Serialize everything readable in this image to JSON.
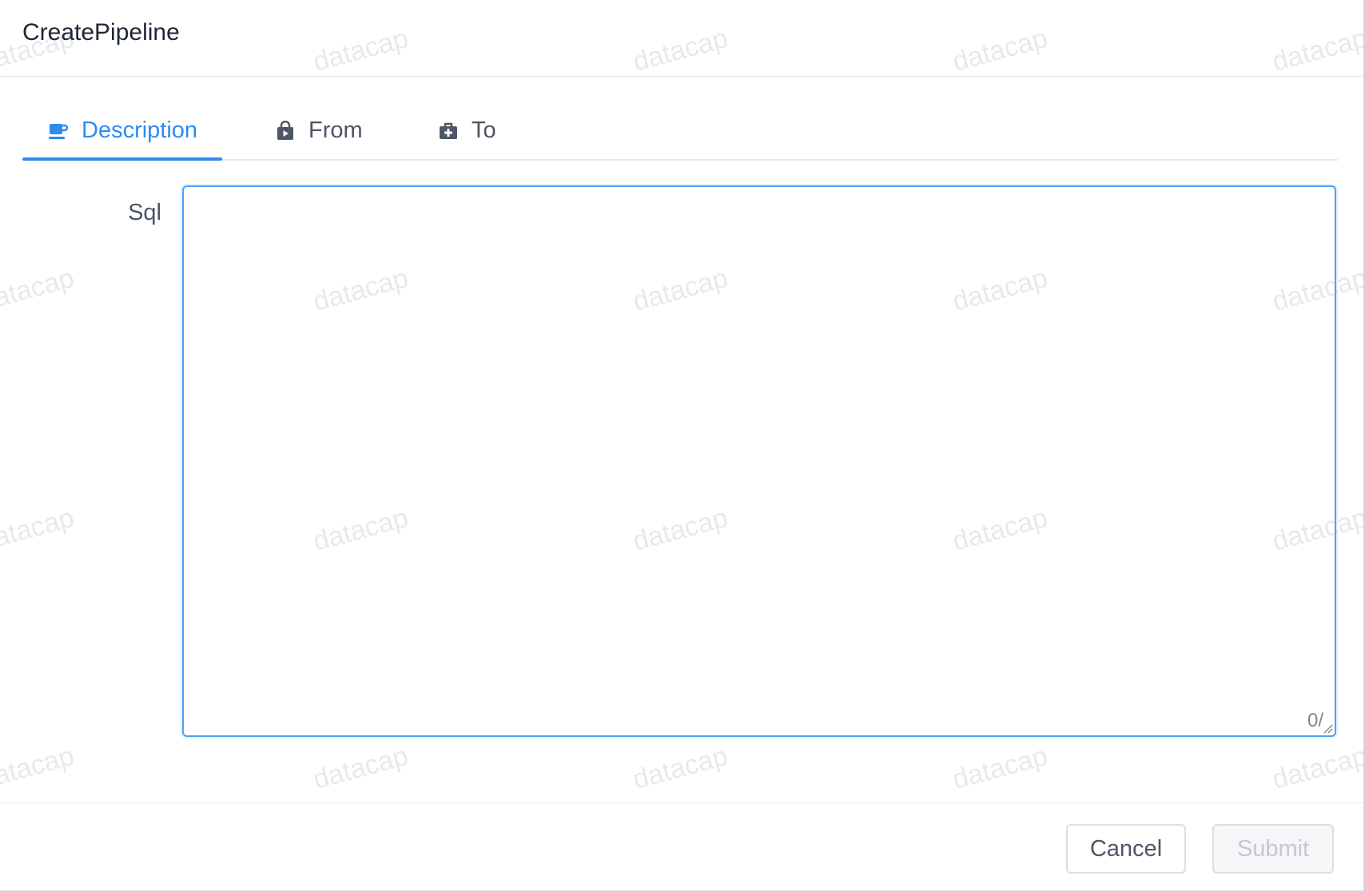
{
  "modal": {
    "title": "CreatePipeline"
  },
  "tabs": [
    {
      "label": "Description",
      "icon": "coffee-cup-icon",
      "active": true
    },
    {
      "label": "From",
      "icon": "shopping-bag-icon",
      "active": false
    },
    {
      "label": "To",
      "icon": "medkit-icon",
      "active": false
    }
  ],
  "form": {
    "sql_label": "Sql",
    "sql_value": "",
    "char_count": "0/"
  },
  "footer": {
    "cancel_label": "Cancel",
    "submit_label": "Submit"
  },
  "watermark": {
    "text": "datacap"
  },
  "colors": {
    "accent": "#2d8cf0",
    "text": "#4d5566",
    "title": "#1f2633",
    "disabled_text": "#c5c8ce"
  }
}
